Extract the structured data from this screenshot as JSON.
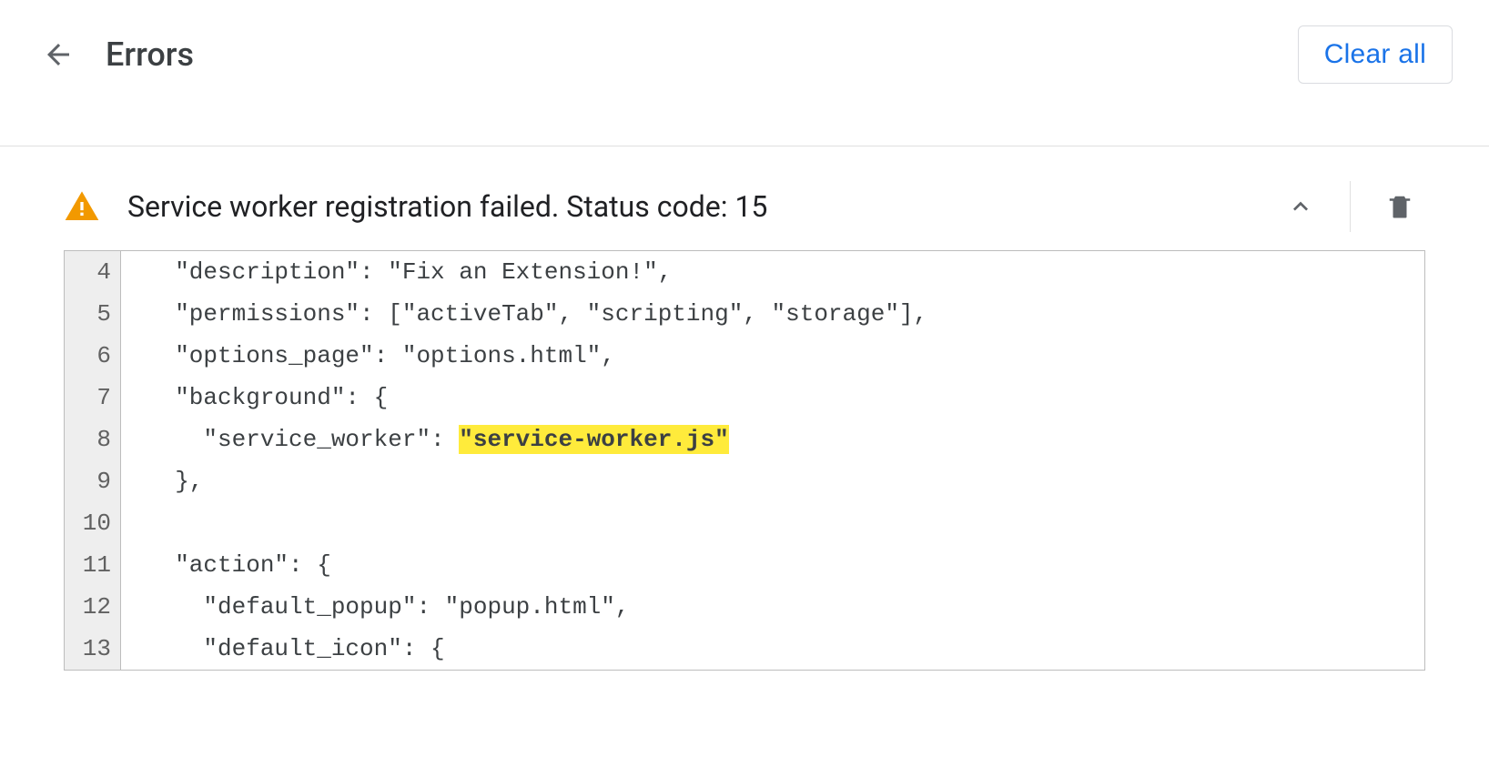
{
  "header": {
    "title": "Errors",
    "clear_all_label": "Clear all"
  },
  "error": {
    "message": "Service worker registration failed. Status code: 15",
    "code_lines": [
      {
        "num": "4",
        "pre": "  \"description\": \"Fix an Extension!\",",
        "hl": "",
        "post": ""
      },
      {
        "num": "5",
        "pre": "  \"permissions\": [\"activeTab\", \"scripting\", \"storage\"],",
        "hl": "",
        "post": ""
      },
      {
        "num": "6",
        "pre": "  \"options_page\": \"options.html\",",
        "hl": "",
        "post": ""
      },
      {
        "num": "7",
        "pre": "  \"background\": {",
        "hl": "",
        "post": ""
      },
      {
        "num": "8",
        "pre": "    \"service_worker\": ",
        "hl": "\"service-worker.js\"",
        "post": ""
      },
      {
        "num": "9",
        "pre": "  },",
        "hl": "",
        "post": ""
      },
      {
        "num": "10",
        "pre": "",
        "hl": "",
        "post": ""
      },
      {
        "num": "11",
        "pre": "  \"action\": {",
        "hl": "",
        "post": ""
      },
      {
        "num": "12",
        "pre": "    \"default_popup\": \"popup.html\",",
        "hl": "",
        "post": ""
      },
      {
        "num": "13",
        "pre": "    \"default_icon\": {",
        "hl": "",
        "post": ""
      }
    ]
  }
}
